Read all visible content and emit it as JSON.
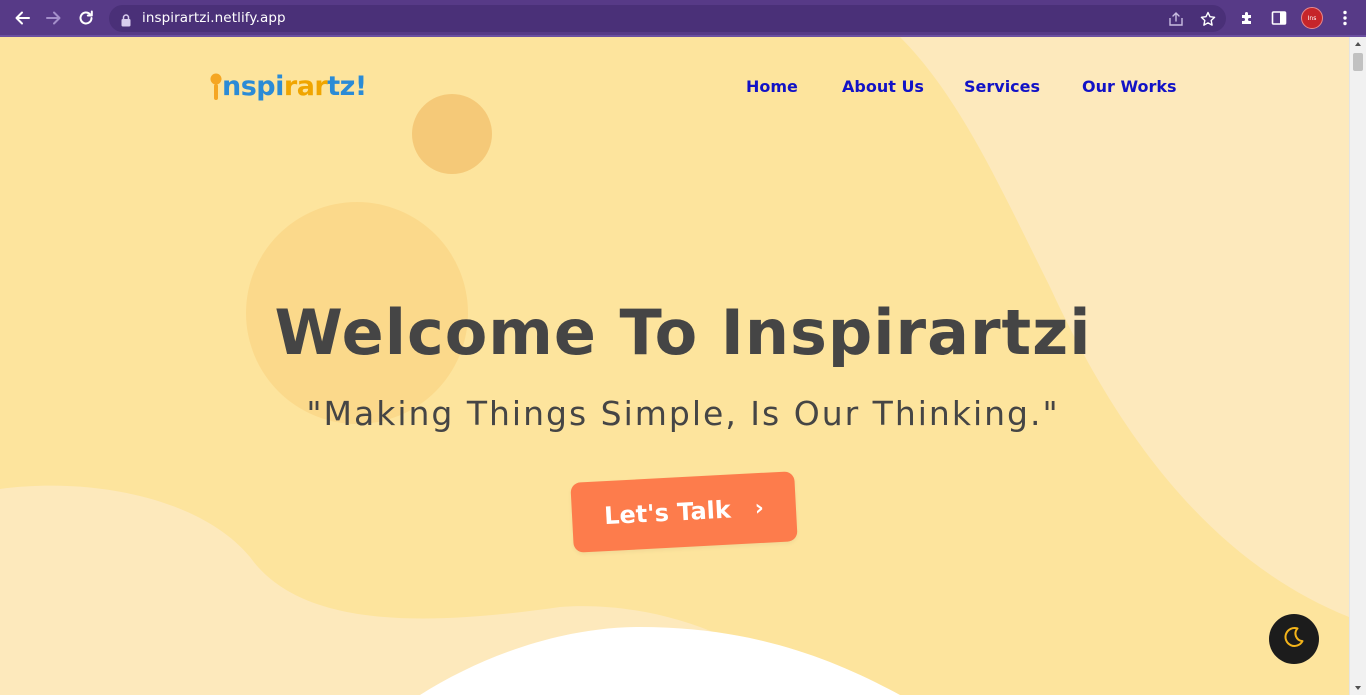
{
  "browser": {
    "url": "inspirartzi.netlify.app",
    "profile_initials": "Ins"
  },
  "site": {
    "logo": {
      "parts": [
        {
          "text": "i",
          "color": "#2b8bd6"
        },
        {
          "text": "nspi",
          "color": "#2b8bd6"
        },
        {
          "text": "r",
          "color": "#f0a500"
        },
        {
          "text": "ar",
          "color": "#f0a500"
        },
        {
          "text": "tz!",
          "color": "#2b8bd6"
        }
      ]
    },
    "nav": [
      {
        "label": "Home"
      },
      {
        "label": "About Us"
      },
      {
        "label": "Services"
      },
      {
        "label": "Our Works"
      }
    ]
  },
  "hero": {
    "title": "Welcome To Inspirartzi",
    "subtitle": "\"Making Things Simple, Is Our Thinking.\"",
    "cta_label": "Let's Talk",
    "cta_arrow": "›"
  },
  "colors": {
    "browser_bar": "#573a87",
    "page_bg": "#fde49d",
    "nav_link": "#1212c6",
    "cta": "#fd7c4c",
    "heading": "#454545",
    "dark_toggle": "#1c1c1c",
    "moon": "#f4b41a"
  },
  "icons": {
    "back": "back-arrow-icon",
    "forward": "forward-arrow-icon",
    "reload": "reload-icon",
    "lock": "lock-icon",
    "share": "share-icon",
    "bookmark": "star-icon",
    "extensions": "puzzle-icon",
    "side_panel": "side-panel-icon",
    "menu": "kebab-menu-icon",
    "dark_mode": "moon-icon"
  }
}
